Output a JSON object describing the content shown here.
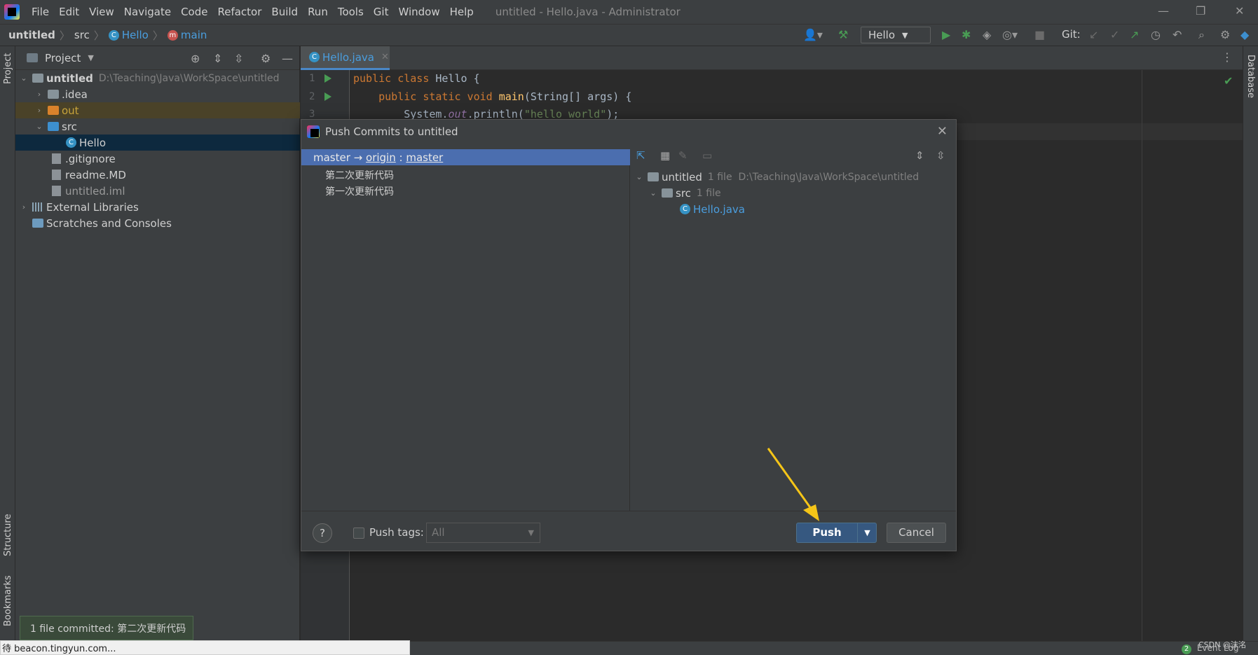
{
  "menubar": {
    "items": [
      "File",
      "Edit",
      "View",
      "Navigate",
      "Code",
      "Refactor",
      "Build",
      "Run",
      "Tools",
      "Git",
      "Window",
      "Help"
    ],
    "title": "untitled - Hello.java - Administrator"
  },
  "navbar": {
    "crumbs": [
      "untitled",
      "src",
      "Hello",
      "main"
    ],
    "run_config": "Hello",
    "git_label": "Git:"
  },
  "sidebar_left": {
    "project": "Project",
    "structure": "Structure",
    "bookmarks": "Bookmarks"
  },
  "sidebar_right": {
    "database": "Database"
  },
  "project_panel": {
    "title": "Project",
    "tree": [
      {
        "label": "untitled",
        "hint": "D:\\Teaching\\Java\\WorkSpace\\untitled"
      },
      {
        "label": ".idea"
      },
      {
        "label": "out"
      },
      {
        "label": "src"
      },
      {
        "label": "Hello"
      },
      {
        "label": ".gitignore"
      },
      {
        "label": "readme.MD"
      },
      {
        "label": "untitled.iml"
      },
      {
        "label": "External Libraries"
      },
      {
        "label": "Scratches and Consoles"
      }
    ]
  },
  "editor": {
    "tab": "Hello.java",
    "line_numbers": [
      "1",
      "2",
      "3"
    ],
    "code": {
      "l1_kw": "public class ",
      "l1_name": "Hello {",
      "l2_kw": "    public static void ",
      "l2_fn": "main",
      "l2_rest": "(String[] args) {",
      "l3_a": "        System.",
      "l3_b": "out",
      "l3_c": ".println(",
      "l3_d": "\"hello world\"",
      "l3_e": ");"
    }
  },
  "dialog": {
    "title": "Push Commits to untitled",
    "branch_local": "master",
    "branch_arrow": " → ",
    "branch_remote": "origin",
    "branch_colon": " : ",
    "branch_target": "master",
    "commits": [
      "第二次更新代码",
      "第一次更新代码"
    ],
    "changes": {
      "root": "untitled",
      "root_hint": "1 file  D:\\Teaching\\Java\\WorkSpace\\untitled",
      "folder": "src",
      "folder_hint": "1 file",
      "file": "Hello.java"
    },
    "help": "?",
    "push_tags_label": "Push tags:",
    "tags_value": "All",
    "push_label": "Push",
    "cancel_label": "Cancel"
  },
  "notification": "1 file committed: 第二次更新代码",
  "browser_status": "待 beacon.tingyun.com...",
  "event_log": {
    "count": "2",
    "label": "Event Log"
  },
  "watermark": "CSDN @沫洺",
  "colors": {
    "accent": "#4b6eaf",
    "push_button": "#365880",
    "arrow": "#f5c518"
  }
}
